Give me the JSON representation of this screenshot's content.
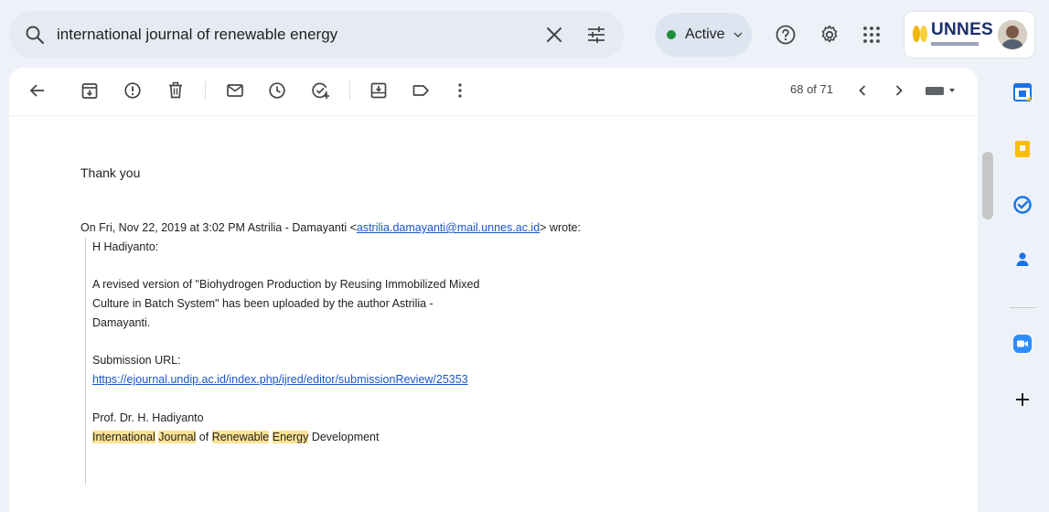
{
  "search": {
    "query": "international journal of renewable energy"
  },
  "status": {
    "label": "Active",
    "color": "#1e8e3e"
  },
  "account": {
    "logo_text": "UNNES"
  },
  "toolbar": {
    "icons": [
      "back-arrow-icon",
      "archive-icon",
      "report-spam-icon",
      "delete-icon",
      "mark-unread-icon",
      "snooze-icon",
      "add-task-icon",
      "move-to-icon",
      "label-icon",
      "more-vert-icon"
    ],
    "counter": "68 of 71"
  },
  "email": {
    "thanks": "Thank you",
    "on_prefix": "On Fri, Nov 22, 2019 at 3:02 PM Astrilia - Damayanti <",
    "on_email": "astrilia.damayanti@mail.unnes.ac.id",
    "on_suffix": "> wrote:",
    "greeting": "H Hadiyanto:",
    "para1_line1": "A revised version of \"Biohydrogen Production by Reusing Immobilized Mixed",
    "para1_line2": "Culture in Batch System\" has been uploaded by the author Astrilia -",
    "para1_line3": "Damayanti.",
    "url_label": "Submission URL:",
    "url": "https://ejournal.undip.ac.id/index.php/ijred/editor/submissionReview/25353",
    "signature_name": "Prof. Dr. H. Hadiyanto",
    "sig_w1": "International",
    "sig_w2": "Journal",
    "sig_of": "of",
    "sig_w3": "Renewable",
    "sig_w4": "Energy",
    "sig_w5": "Development"
  },
  "colors": {
    "highlight": "#fde293",
    "link": "#1a55c9"
  }
}
